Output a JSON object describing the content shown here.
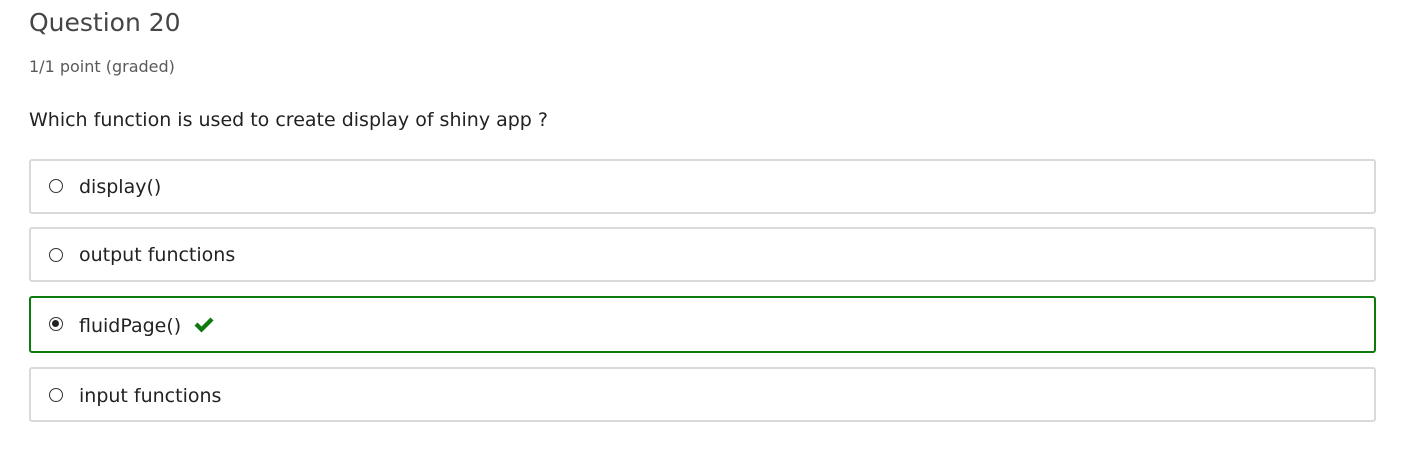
{
  "question": {
    "title": "Question 20",
    "points": "1/1 point (graded)",
    "prompt": "Which function is used to create display of shiny app ?"
  },
  "choices": [
    {
      "label": "display()",
      "selected": false,
      "correct": false
    },
    {
      "label": "output functions",
      "selected": false,
      "correct": false
    },
    {
      "label": "fluidPage()",
      "selected": true,
      "correct": true
    },
    {
      "label": "input functions",
      "selected": false,
      "correct": false
    }
  ],
  "colors": {
    "correct": "#0c7a0c",
    "border": "#d9d9d9",
    "text": "#222222"
  },
  "icons": {
    "correct_mark": "checkmark-icon"
  }
}
